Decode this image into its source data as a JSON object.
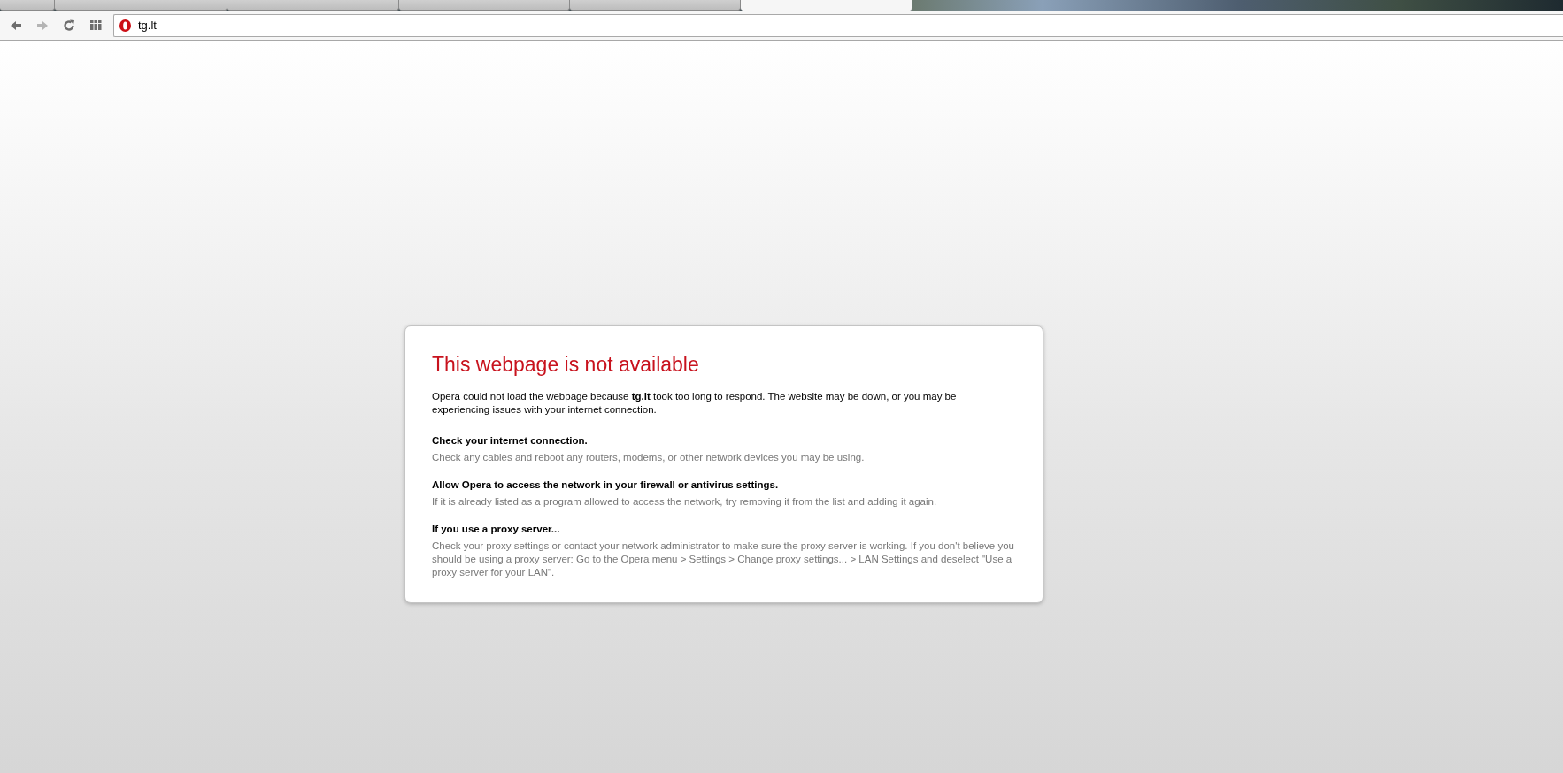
{
  "tabs": [
    {
      "selected": false
    },
    {
      "selected": false
    },
    {
      "selected": false
    },
    {
      "selected": false
    },
    {
      "selected": false
    },
    {
      "selected": true
    }
  ],
  "address_bar": {
    "value": "tg.lt"
  },
  "error": {
    "title": "This webpage is not available",
    "intro": "Opera could not load the webpage because **tg.lt** took too long to respond. The website may be down, or you may be experiencing issues with your internet connection.",
    "sections": [
      {
        "heading": "Check your internet connection.",
        "text": "Check any cables and reboot any routers, modems, or other network devices you may be using."
      },
      {
        "heading": "Allow Opera to access the network in your firewall or antivirus settings.",
        "text": "If it is already listed as a program allowed to access the network, try removing it from the list and adding it again."
      },
      {
        "heading": "If you use a proxy server...",
        "text": "Check your proxy settings or contact your network administrator to make sure the proxy server is working. If you don't believe you should be using a proxy server: Go to the Opera menu > Settings > Change proxy settings... > LAN Settings and deselect \"Use a proxy server for your LAN\"."
      }
    ]
  }
}
